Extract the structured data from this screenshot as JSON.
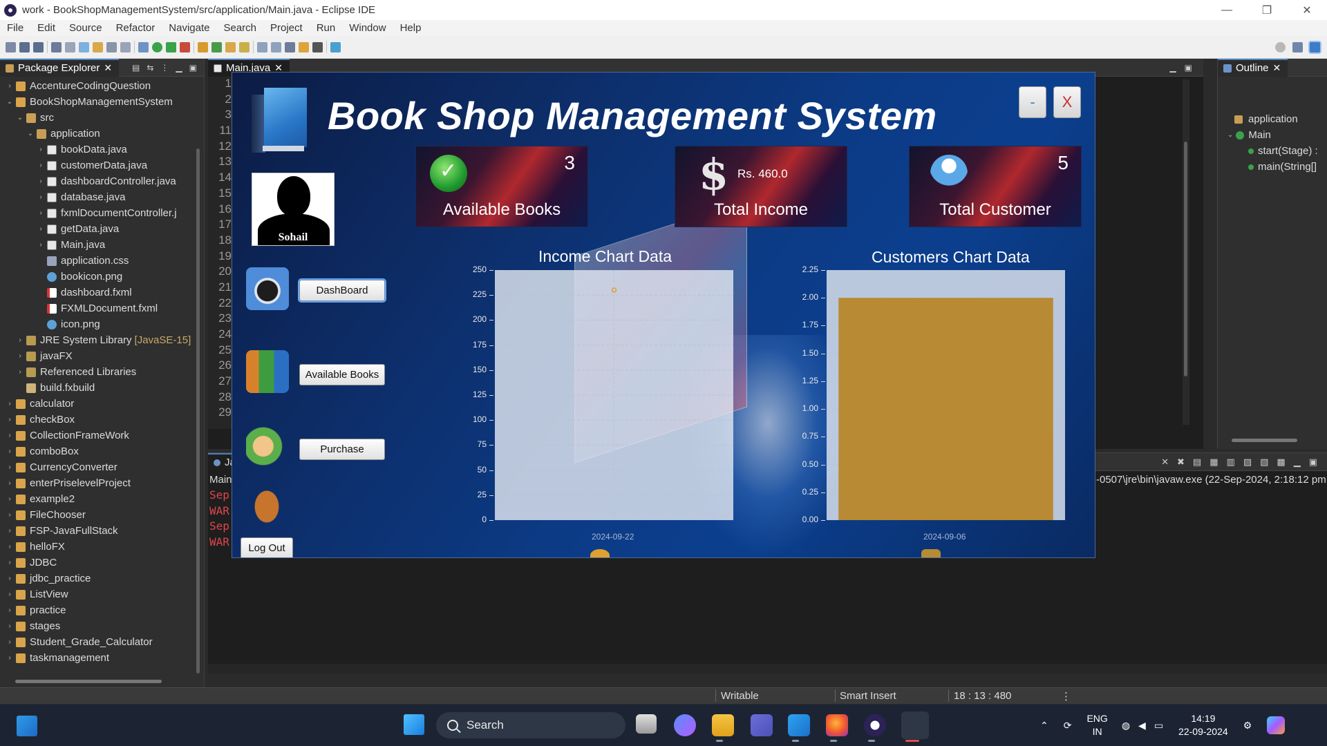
{
  "window": {
    "title": "work - BookShopManagementSystem/src/application/Main.java - Eclipse IDE",
    "minimize": "—",
    "restore": "❐",
    "close": "✕"
  },
  "menu": [
    "File",
    "Edit",
    "Source",
    "Refactor",
    "Navigate",
    "Search",
    "Project",
    "Run",
    "Window",
    "Help"
  ],
  "package_explorer": {
    "tab_label": "Package Explorer",
    "items": [
      {
        "label": "AccentureCodingQuestion",
        "icon": "project-icon"
      },
      {
        "label": "BookShopManagementSystem",
        "icon": "project-icon"
      },
      {
        "label": "src",
        "icon": "src-folder-icon"
      },
      {
        "label": "application",
        "icon": "package-icon"
      },
      {
        "label": "bookData.java",
        "icon": "java-file-icon"
      },
      {
        "label": "customerData.java",
        "icon": "java-file-icon"
      },
      {
        "label": "dashboardController.java",
        "icon": "java-file-icon"
      },
      {
        "label": "database.java",
        "icon": "java-file-icon"
      },
      {
        "label": "fxmlDocumentController.j",
        "icon": "java-file-icon"
      },
      {
        "label": "getData.java",
        "icon": "java-file-icon"
      },
      {
        "label": "Main.java",
        "icon": "java-file-icon"
      },
      {
        "label": "application.css",
        "icon": "css-file-icon"
      },
      {
        "label": "bookicon.png",
        "icon": "image-file-icon"
      },
      {
        "label": "dashboard.fxml",
        "icon": "fxml-file-icon"
      },
      {
        "label": "FXMLDocument.fxml",
        "icon": "fxml-file-icon"
      },
      {
        "label": "icon.png",
        "icon": "image-file-icon"
      },
      {
        "label": "JRE System Library",
        "tag": "[JavaSE-15]",
        "icon": "library-icon"
      },
      {
        "label": "javaFX",
        "icon": "library-icon"
      },
      {
        "label": "Referenced Libraries",
        "icon": "library-icon"
      },
      {
        "label": "build.fxbuild",
        "icon": "build-file-icon"
      },
      {
        "label": "calculator",
        "icon": "project-icon"
      },
      {
        "label": "checkBox",
        "icon": "project-icon"
      },
      {
        "label": "CollectionFrameWork",
        "icon": "project-icon"
      },
      {
        "label": "comboBox",
        "icon": "project-icon"
      },
      {
        "label": "CurrencyConverter",
        "icon": "project-icon"
      },
      {
        "label": "enterPriselevelProject",
        "icon": "project-icon"
      },
      {
        "label": "example2",
        "icon": "project-icon"
      },
      {
        "label": "FileChooser",
        "icon": "project-icon"
      },
      {
        "label": "FSP-JavaFullStack",
        "icon": "project-icon"
      },
      {
        "label": "helloFX",
        "icon": "project-icon"
      },
      {
        "label": "JDBC",
        "icon": "project-icon"
      },
      {
        "label": "jdbc_practice",
        "icon": "project-icon"
      },
      {
        "label": "ListView",
        "icon": "project-icon"
      },
      {
        "label": "practice",
        "icon": "project-icon"
      },
      {
        "label": "stages",
        "icon": "project-icon"
      },
      {
        "label": "Student_Grade_Calculator",
        "icon": "project-icon"
      },
      {
        "label": "taskmanagement",
        "icon": "project-icon"
      }
    ]
  },
  "editor": {
    "tab_label": "Main.java",
    "line_numbers": [
      "1",
      "2",
      "3",
      "11",
      "12",
      "13",
      "14",
      "15",
      "16",
      "17",
      "18",
      "19",
      "20",
      "21",
      "22",
      "23",
      "24",
      "25",
      "26",
      "27",
      "28",
      "29"
    ]
  },
  "outline": {
    "tab_label": "Outline",
    "items": [
      {
        "label": "application"
      },
      {
        "label": "Main"
      },
      {
        "label": "start(Stage) :"
      },
      {
        "label": "main(String[]"
      }
    ]
  },
  "console": {
    "tab_label": "Ja",
    "main_label": "Main",
    "path": "-0507\\jre\\bin\\javaw.exe  (22-Sep-2024, 2:18:12 pm",
    "lines": [
      "Sep",
      "WAR",
      "Sep",
      "WAR"
    ]
  },
  "status": {
    "writable": "Writable",
    "insert_mode": "Smart Insert",
    "position": "18 : 13 : 480"
  },
  "app": {
    "title": "Book Shop Management System",
    "minimize_label": "-",
    "close_label": "X",
    "username": "Sohail",
    "nav": [
      {
        "label": "DashBoard",
        "icon": "dashboard-icon"
      },
      {
        "label": "Available Books",
        "icon": "books-icon"
      },
      {
        "label": "Purchase",
        "icon": "purchase-icon"
      }
    ],
    "logout_label": "Log Out",
    "cards": [
      {
        "label": "Available Books",
        "value": "3",
        "icon": "checkmark-icon"
      },
      {
        "label": "Total Income",
        "value": "Rs. 460.0",
        "icon": "dollar-icon"
      },
      {
        "label": "Total Customer",
        "value": "5",
        "icon": "customers-icon"
      }
    ]
  },
  "taskbar": {
    "search_label": "Search",
    "lang_top": "ENG",
    "lang_bottom": "IN",
    "time": "14:19",
    "date": "22-09-2024"
  },
  "chart_data": [
    {
      "type": "scatter",
      "title": "Income Chart Data",
      "x": [
        "2024-09-22"
      ],
      "xlabel": "",
      "ylabel": "",
      "ylim": [
        0,
        250
      ],
      "yticks": [
        0,
        25,
        50,
        75,
        100,
        125,
        150,
        175,
        200,
        225,
        250
      ],
      "series": [
        {
          "values": [
            230
          ],
          "color": "#e0a030"
        }
      ],
      "grid": true
    },
    {
      "type": "bar",
      "title": "Customers Chart Data",
      "categories": [
        "2024-09-06"
      ],
      "xlabel": "",
      "ylabel": "",
      "ylim": [
        0,
        2.25
      ],
      "yticks": [
        "0.00",
        "0.25",
        "0.50",
        "0.75",
        "1.00",
        "1.25",
        "1.50",
        "1.75",
        "2.00",
        "2.25"
      ],
      "series": [
        {
          "values": [
            2.0
          ],
          "color": "#b78a33"
        }
      ],
      "grid": true
    }
  ]
}
